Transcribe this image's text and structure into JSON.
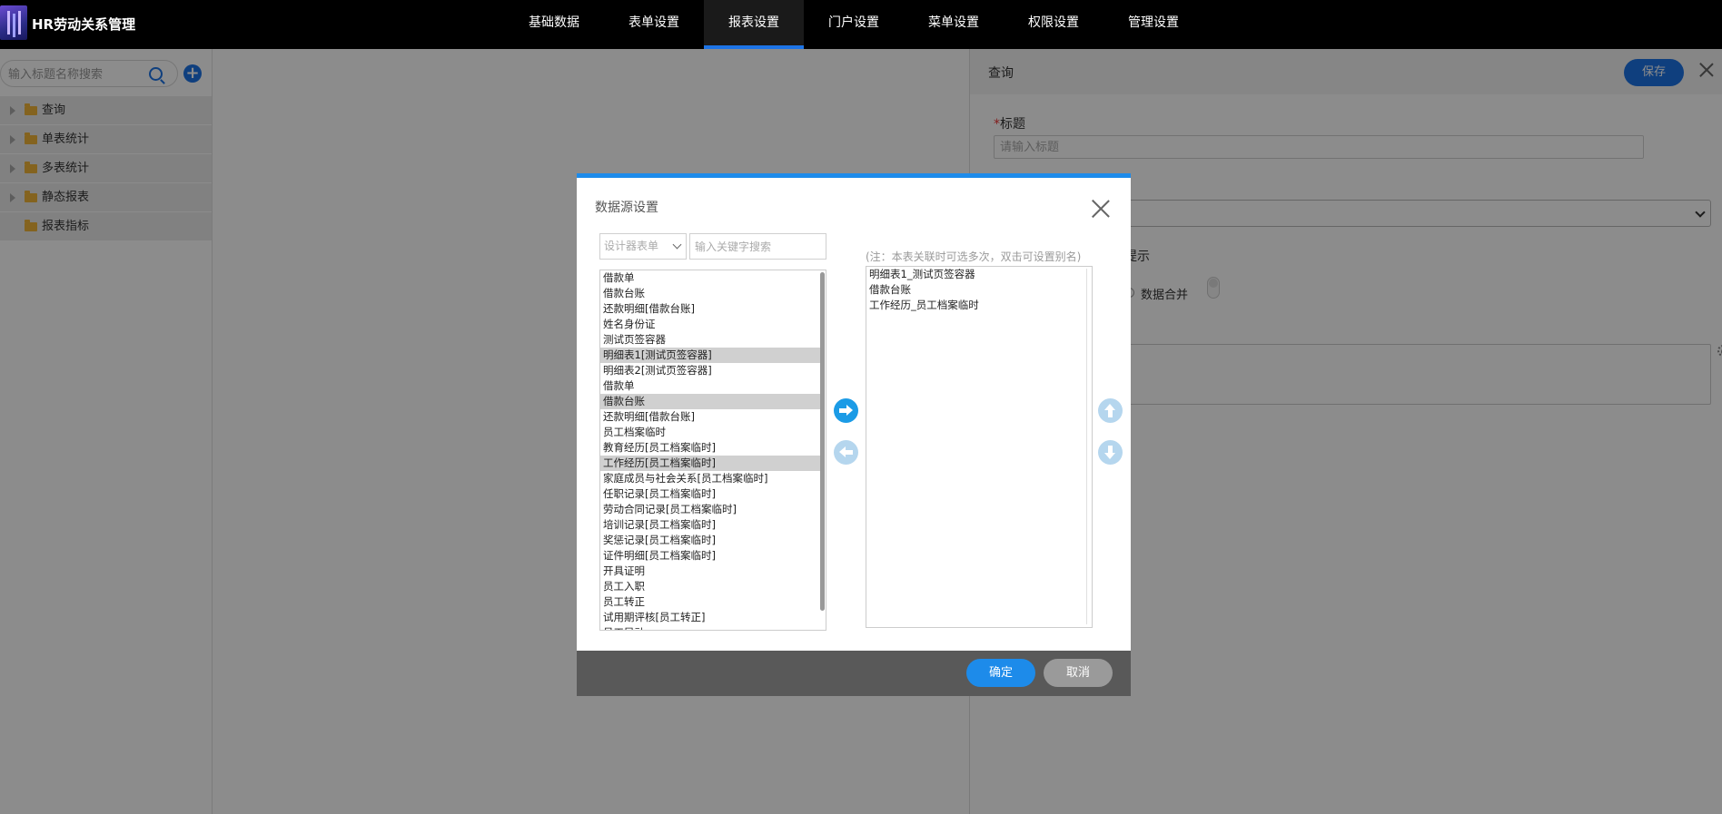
{
  "app": {
    "title": "HR劳动关系管理"
  },
  "nav": [
    "基础数据",
    "表单设置",
    "报表设置",
    "门户设置",
    "菜单设置",
    "权限设置",
    "管理设置"
  ],
  "nav_active": "报表设置",
  "sidebar": {
    "search_placeholder": "输入标题名称搜索",
    "items": [
      {
        "label": "查询",
        "expandable": true
      },
      {
        "label": "单表统计",
        "expandable": true
      },
      {
        "label": "多表统计",
        "expandable": true
      },
      {
        "label": "静态报表",
        "expandable": true
      },
      {
        "label": "报表指标",
        "expandable": false
      }
    ]
  },
  "right_panel": {
    "title": "查询",
    "save_label": "保存",
    "title_field_label": "标题",
    "title_field_placeholder": "请输入标题",
    "partial_hint_text": "提示",
    "merge_option_label": "数据合并"
  },
  "modal": {
    "title": "数据源设置",
    "source_select_value": "设计器表单",
    "keyword_placeholder": "输入关键字搜索",
    "note": "(注：本表关联时可选多次，双击可设置别名)",
    "source_items": [
      {
        "label": "借款单",
        "selected": false
      },
      {
        "label": "借款台账",
        "selected": false
      },
      {
        "label": "还款明细[借款台账]",
        "selected": false
      },
      {
        "label": "姓名身份证",
        "selected": false
      },
      {
        "label": "测试页签容器",
        "selected": false
      },
      {
        "label": "明细表1[测试页签容器]",
        "selected": true
      },
      {
        "label": "明细表2[测试页签容器]",
        "selected": false
      },
      {
        "label": "借款单",
        "selected": false
      },
      {
        "label": "借款台账",
        "selected": true
      },
      {
        "label": "还款明细[借款台账]",
        "selected": false
      },
      {
        "label": "员工档案临时",
        "selected": false
      },
      {
        "label": "教育经历[员工档案临时]",
        "selected": false
      },
      {
        "label": "工作经历[员工档案临时]",
        "selected": true
      },
      {
        "label": "家庭成员与社会关系[员工档案临时]",
        "selected": false
      },
      {
        "label": "任职记录[员工档案临时]",
        "selected": false
      },
      {
        "label": "劳动合同记录[员工档案临时]",
        "selected": false
      },
      {
        "label": "培训记录[员工档案临时]",
        "selected": false
      },
      {
        "label": "奖惩记录[员工档案临时]",
        "selected": false
      },
      {
        "label": "证件明细[员工档案临时]",
        "selected": false
      },
      {
        "label": "开具证明",
        "selected": false
      },
      {
        "label": "员工入职",
        "selected": false
      },
      {
        "label": "员工转正",
        "selected": false
      },
      {
        "label": "试用期评核[员工转正]",
        "selected": false
      },
      {
        "label": "员工异动",
        "selected": false
      }
    ],
    "selected_items": [
      "明细表1_测试页签容器",
      "借款台账",
      "工作经历_员工档案临时"
    ],
    "ok_label": "确定",
    "cancel_label": "取消"
  },
  "colors": {
    "accent": "#1d74e6",
    "modal_accent": "#1d8bea",
    "topbar": "#000000"
  }
}
